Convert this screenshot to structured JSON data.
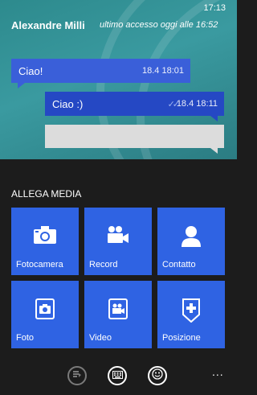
{
  "status_bar": {
    "time": "17:13"
  },
  "chat": {
    "contact_name": "Alexandre Milli",
    "last_seen": "ultimo accesso oggi alle 16:52",
    "messages": [
      {
        "text": "Ciao!",
        "time": "18.4 18:01",
        "direction": "incoming"
      },
      {
        "text": "Ciao :)",
        "time": "18.4 18:11",
        "direction": "outgoing",
        "status": "read-double-check"
      },
      {
        "text": "",
        "time": "",
        "direction": "outgoing",
        "status": "draft"
      }
    ]
  },
  "attach_panel": {
    "title": "ALLEGA MEDIA",
    "tiles": [
      {
        "label": "Fotocamera",
        "icon": "camera-icon"
      },
      {
        "label": "Record",
        "icon": "video-camera-icon"
      },
      {
        "label": "Contatto",
        "icon": "contact-person-icon"
      },
      {
        "label": "Foto",
        "icon": "photo-picture-icon"
      },
      {
        "label": "Video",
        "icon": "video-picture-icon"
      },
      {
        "label": "Posizione",
        "icon": "location-pin-icon"
      }
    ]
  },
  "app_bar": {
    "buttons": [
      {
        "icon": "quick-replies-icon",
        "enabled": false
      },
      {
        "icon": "keyboard-icon",
        "enabled": true
      },
      {
        "icon": "emoji-smiley-icon",
        "enabled": true
      }
    ],
    "more": "..."
  },
  "colors": {
    "incoming_bubble": "#3a5fd9",
    "outgoing_bubble": "#2548c4",
    "tile_accent": "#2f63e3",
    "chat_background": "#3a9aa0",
    "panel_background": "#1c1c1c"
  }
}
